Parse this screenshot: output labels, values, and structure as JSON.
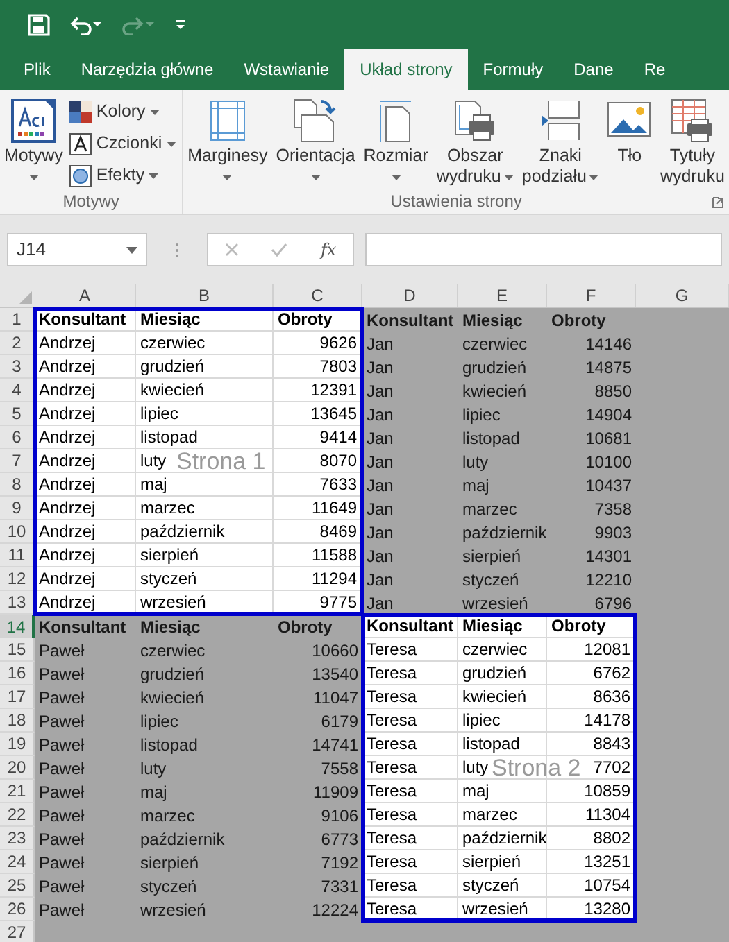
{
  "tabs": [
    {
      "label": "Plik",
      "selected": false
    },
    {
      "label": "Narzędzia główne",
      "selected": false
    },
    {
      "label": "Wstawianie",
      "selected": false
    },
    {
      "label": "Układ strony",
      "selected": true
    },
    {
      "label": "Formuły",
      "selected": false
    },
    {
      "label": "Dane",
      "selected": false
    },
    {
      "label": "Re",
      "selected": false
    }
  ],
  "ribbon": {
    "groups": [
      {
        "label": "Motywy",
        "large": [
          {
            "kind": "themes",
            "label_lines": [
              "Motywy"
            ],
            "dropdown": true
          }
        ],
        "small": [
          {
            "kind": "colors",
            "label": "Kolory",
            "dropdown": true
          },
          {
            "kind": "fonts",
            "label": "Czcionki",
            "dropdown": true
          },
          {
            "kind": "effects",
            "label": "Efekty",
            "dropdown": true
          }
        ]
      },
      {
        "label": "Ustawienia strony",
        "large": [
          {
            "kind": "margins",
            "label_lines": [
              "Marginesy"
            ],
            "dropdown": true
          },
          {
            "kind": "orientation",
            "label_lines": [
              "Orientacja"
            ],
            "dropdown": true
          },
          {
            "kind": "size",
            "label_lines": [
              "Rozmiar"
            ],
            "dropdown": true
          },
          {
            "kind": "print_area",
            "label_lines": [
              "Obszar",
              "wydruku"
            ],
            "dropdown": true
          },
          {
            "kind": "breaks",
            "label_lines": [
              "Znaki",
              "podziału"
            ],
            "dropdown": true
          },
          {
            "kind": "background",
            "label_lines": [
              "Tło"
            ],
            "dropdown": false
          },
          {
            "kind": "print_titles",
            "label_lines": [
              "Tytuły",
              "wydruku"
            ],
            "dropdown": false
          }
        ]
      }
    ]
  },
  "formula_bar": {
    "name_box": "J14",
    "function_button": "fx"
  },
  "sheet": {
    "columns": [
      "A",
      "B",
      "C",
      "D",
      "E",
      "F",
      "G"
    ],
    "pages": [
      {
        "label": "Strona 1"
      },
      {
        "label": "Strona 2"
      }
    ],
    "rows": [
      {
        "number": "1",
        "selected": false,
        "kind": "header",
        "cells": [
          {
            "text": "Konsultant",
            "printed": true
          },
          {
            "text": "Miesiąc",
            "printed": true
          },
          {
            "text": "Obroty",
            "printed": true
          },
          {
            "text": "Konsultant",
            "printed": false
          },
          {
            "text": "Miesiąc",
            "printed": false
          },
          {
            "text": "Obroty",
            "printed": false
          }
        ]
      },
      {
        "number": "2",
        "selected": false,
        "kind": "data",
        "cells": [
          {
            "text": "Andrzej",
            "printed": true
          },
          {
            "text": "czerwiec",
            "printed": true
          },
          {
            "text": "9626",
            "printed": true
          },
          {
            "text": "Jan",
            "printed": false
          },
          {
            "text": "czerwiec",
            "printed": false
          },
          {
            "text": "14146",
            "printed": false
          }
        ]
      },
      {
        "number": "3",
        "selected": false,
        "kind": "data",
        "cells": [
          {
            "text": "Andrzej",
            "printed": true
          },
          {
            "text": "grudzień",
            "printed": true
          },
          {
            "text": "7803",
            "printed": true
          },
          {
            "text": "Jan",
            "printed": false
          },
          {
            "text": "grudzień",
            "printed": false
          },
          {
            "text": "14875",
            "printed": false
          }
        ]
      },
      {
        "number": "4",
        "selected": false,
        "kind": "data",
        "cells": [
          {
            "text": "Andrzej",
            "printed": true
          },
          {
            "text": "kwiecień",
            "printed": true
          },
          {
            "text": "12391",
            "printed": true
          },
          {
            "text": "Jan",
            "printed": false
          },
          {
            "text": "kwiecień",
            "printed": false
          },
          {
            "text": "8850",
            "printed": false
          }
        ]
      },
      {
        "number": "5",
        "selected": false,
        "kind": "data",
        "cells": [
          {
            "text": "Andrzej",
            "printed": true
          },
          {
            "text": "lipiec",
            "printed": true
          },
          {
            "text": "13645",
            "printed": true
          },
          {
            "text": "Jan",
            "printed": false
          },
          {
            "text": "lipiec",
            "printed": false
          },
          {
            "text": "14904",
            "printed": false
          }
        ]
      },
      {
        "number": "6",
        "selected": false,
        "kind": "data",
        "cells": [
          {
            "text": "Andrzej",
            "printed": true
          },
          {
            "text": "listopad",
            "printed": true
          },
          {
            "text": "9414",
            "printed": true
          },
          {
            "text": "Jan",
            "printed": false
          },
          {
            "text": "listopad",
            "printed": false
          },
          {
            "text": "10681",
            "printed": false
          }
        ]
      },
      {
        "number": "7",
        "selected": false,
        "kind": "data",
        "cells": [
          {
            "text": "Andrzej",
            "printed": true
          },
          {
            "text": "luty",
            "printed": true
          },
          {
            "text": "8070",
            "printed": true
          },
          {
            "text": "Jan",
            "printed": false
          },
          {
            "text": "luty",
            "printed": false
          },
          {
            "text": "10100",
            "printed": false
          }
        ]
      },
      {
        "number": "8",
        "selected": false,
        "kind": "data",
        "cells": [
          {
            "text": "Andrzej",
            "printed": true
          },
          {
            "text": "maj",
            "printed": true
          },
          {
            "text": "7633",
            "printed": true
          },
          {
            "text": "Jan",
            "printed": false
          },
          {
            "text": "maj",
            "printed": false
          },
          {
            "text": "10437",
            "printed": false
          }
        ]
      },
      {
        "number": "9",
        "selected": false,
        "kind": "data",
        "cells": [
          {
            "text": "Andrzej",
            "printed": true
          },
          {
            "text": "marzec",
            "printed": true
          },
          {
            "text": "11649",
            "printed": true
          },
          {
            "text": "Jan",
            "printed": false
          },
          {
            "text": "marzec",
            "printed": false
          },
          {
            "text": "7358",
            "printed": false
          }
        ]
      },
      {
        "number": "10",
        "selected": false,
        "kind": "data",
        "cells": [
          {
            "text": "Andrzej",
            "printed": true
          },
          {
            "text": "październik",
            "printed": true
          },
          {
            "text": "8469",
            "printed": true
          },
          {
            "text": "Jan",
            "printed": false
          },
          {
            "text": "październik",
            "printed": false
          },
          {
            "text": "9903",
            "printed": false
          }
        ]
      },
      {
        "number": "11",
        "selected": false,
        "kind": "data",
        "cells": [
          {
            "text": "Andrzej",
            "printed": true
          },
          {
            "text": "sierpień",
            "printed": true
          },
          {
            "text": "11588",
            "printed": true
          },
          {
            "text": "Jan",
            "printed": false
          },
          {
            "text": "sierpień",
            "printed": false
          },
          {
            "text": "14301",
            "printed": false
          }
        ]
      },
      {
        "number": "12",
        "selected": false,
        "kind": "data",
        "cells": [
          {
            "text": "Andrzej",
            "printed": true
          },
          {
            "text": "styczeń",
            "printed": true
          },
          {
            "text": "11294",
            "printed": true
          },
          {
            "text": "Jan",
            "printed": false
          },
          {
            "text": "styczeń",
            "printed": false
          },
          {
            "text": "12210",
            "printed": false
          }
        ]
      },
      {
        "number": "13",
        "selected": false,
        "kind": "data",
        "cells": [
          {
            "text": "Andrzej",
            "printed": true
          },
          {
            "text": "wrzesień",
            "printed": true
          },
          {
            "text": "9775",
            "printed": true
          },
          {
            "text": "Jan",
            "printed": false
          },
          {
            "text": "wrzesień",
            "printed": false
          },
          {
            "text": "6796",
            "printed": false
          }
        ]
      },
      {
        "number": "14",
        "selected": true,
        "kind": "header",
        "cells": [
          {
            "text": "Konsultant",
            "printed": false
          },
          {
            "text": "Miesiąc",
            "printed": false
          },
          {
            "text": "Obroty",
            "printed": false
          },
          {
            "text": "Konsultant",
            "printed": true
          },
          {
            "text": "Miesiąc",
            "printed": true
          },
          {
            "text": "Obroty",
            "printed": true
          }
        ]
      },
      {
        "number": "15",
        "selected": false,
        "kind": "data",
        "cells": [
          {
            "text": "Paweł",
            "printed": false
          },
          {
            "text": "czerwiec",
            "printed": false
          },
          {
            "text": "10660",
            "printed": false
          },
          {
            "text": "Teresa",
            "printed": true
          },
          {
            "text": "czerwiec",
            "printed": true
          },
          {
            "text": "12081",
            "printed": true
          }
        ]
      },
      {
        "number": "16",
        "selected": false,
        "kind": "data",
        "cells": [
          {
            "text": "Paweł",
            "printed": false
          },
          {
            "text": "grudzień",
            "printed": false
          },
          {
            "text": "13540",
            "printed": false
          },
          {
            "text": "Teresa",
            "printed": true
          },
          {
            "text": "grudzień",
            "printed": true
          },
          {
            "text": "6762",
            "printed": true
          }
        ]
      },
      {
        "number": "17",
        "selected": false,
        "kind": "data",
        "cells": [
          {
            "text": "Paweł",
            "printed": false
          },
          {
            "text": "kwiecień",
            "printed": false
          },
          {
            "text": "11047",
            "printed": false
          },
          {
            "text": "Teresa",
            "printed": true
          },
          {
            "text": "kwiecień",
            "printed": true
          },
          {
            "text": "8636",
            "printed": true
          }
        ]
      },
      {
        "number": "18",
        "selected": false,
        "kind": "data",
        "cells": [
          {
            "text": "Paweł",
            "printed": false
          },
          {
            "text": "lipiec",
            "printed": false
          },
          {
            "text": "6179",
            "printed": false
          },
          {
            "text": "Teresa",
            "printed": true
          },
          {
            "text": "lipiec",
            "printed": true
          },
          {
            "text": "14178",
            "printed": true
          }
        ]
      },
      {
        "number": "19",
        "selected": false,
        "kind": "data",
        "cells": [
          {
            "text": "Paweł",
            "printed": false
          },
          {
            "text": "listopad",
            "printed": false
          },
          {
            "text": "14741",
            "printed": false
          },
          {
            "text": "Teresa",
            "printed": true
          },
          {
            "text": "listopad",
            "printed": true
          },
          {
            "text": "8843",
            "printed": true
          }
        ]
      },
      {
        "number": "20",
        "selected": false,
        "kind": "data",
        "cells": [
          {
            "text": "Paweł",
            "printed": false
          },
          {
            "text": "luty",
            "printed": false
          },
          {
            "text": "7558",
            "printed": false
          },
          {
            "text": "Teresa",
            "printed": true
          },
          {
            "text": "luty",
            "printed": true
          },
          {
            "text": "7702",
            "printed": true
          }
        ]
      },
      {
        "number": "21",
        "selected": false,
        "kind": "data",
        "cells": [
          {
            "text": "Paweł",
            "printed": false
          },
          {
            "text": "maj",
            "printed": false
          },
          {
            "text": "11909",
            "printed": false
          },
          {
            "text": "Teresa",
            "printed": true
          },
          {
            "text": "maj",
            "printed": true
          },
          {
            "text": "10859",
            "printed": true
          }
        ]
      },
      {
        "number": "22",
        "selected": false,
        "kind": "data",
        "cells": [
          {
            "text": "Paweł",
            "printed": false
          },
          {
            "text": "marzec",
            "printed": false
          },
          {
            "text": "9106",
            "printed": false
          },
          {
            "text": "Teresa",
            "printed": true
          },
          {
            "text": "marzec",
            "printed": true
          },
          {
            "text": "11304",
            "printed": true
          }
        ]
      },
      {
        "number": "23",
        "selected": false,
        "kind": "data",
        "cells": [
          {
            "text": "Paweł",
            "printed": false
          },
          {
            "text": "październik",
            "printed": false
          },
          {
            "text": "6773",
            "printed": false
          },
          {
            "text": "Teresa",
            "printed": true
          },
          {
            "text": "październik",
            "printed": true
          },
          {
            "text": "8802",
            "printed": true
          }
        ]
      },
      {
        "number": "24",
        "selected": false,
        "kind": "data",
        "cells": [
          {
            "text": "Paweł",
            "printed": false
          },
          {
            "text": "sierpień",
            "printed": false
          },
          {
            "text": "7192",
            "printed": false
          },
          {
            "text": "Teresa",
            "printed": true
          },
          {
            "text": "sierpień",
            "printed": true
          },
          {
            "text": "13251",
            "printed": true
          }
        ]
      },
      {
        "number": "25",
        "selected": false,
        "kind": "data",
        "cells": [
          {
            "text": "Paweł",
            "printed": false
          },
          {
            "text": "styczeń",
            "printed": false
          },
          {
            "text": "7331",
            "printed": false
          },
          {
            "text": "Teresa",
            "printed": true
          },
          {
            "text": "styczeń",
            "printed": true
          },
          {
            "text": "10754",
            "printed": true
          }
        ]
      },
      {
        "number": "26",
        "selected": false,
        "kind": "data",
        "cells": [
          {
            "text": "Paweł",
            "printed": false
          },
          {
            "text": "wrzesień",
            "printed": false
          },
          {
            "text": "12224",
            "printed": false
          },
          {
            "text": "Teresa",
            "printed": true
          },
          {
            "text": "wrzesień",
            "printed": true
          },
          {
            "text": "13280",
            "printed": true
          }
        ]
      },
      {
        "number": "27",
        "selected": false,
        "kind": "data",
        "cells": []
      }
    ]
  }
}
